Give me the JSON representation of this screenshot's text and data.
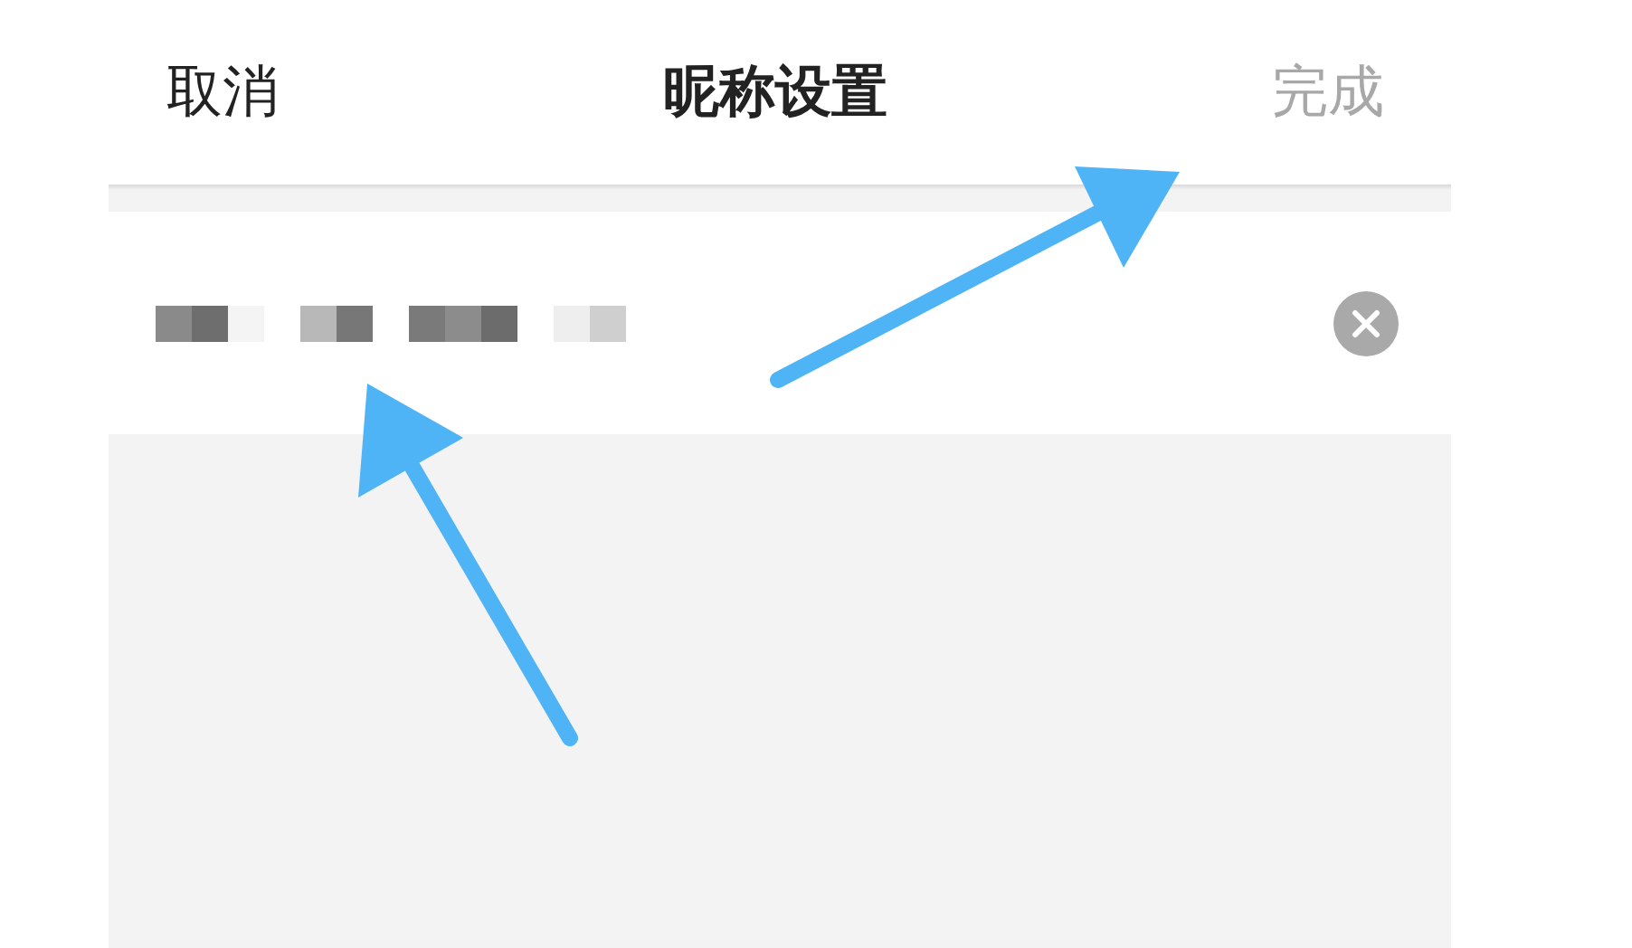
{
  "nav_bar": {
    "cancel": "取消",
    "title": "昵称设置",
    "done": {
      "label": "完成",
      "disabled": true
    }
  },
  "nickname_field": {
    "clear_button": true
  }
}
